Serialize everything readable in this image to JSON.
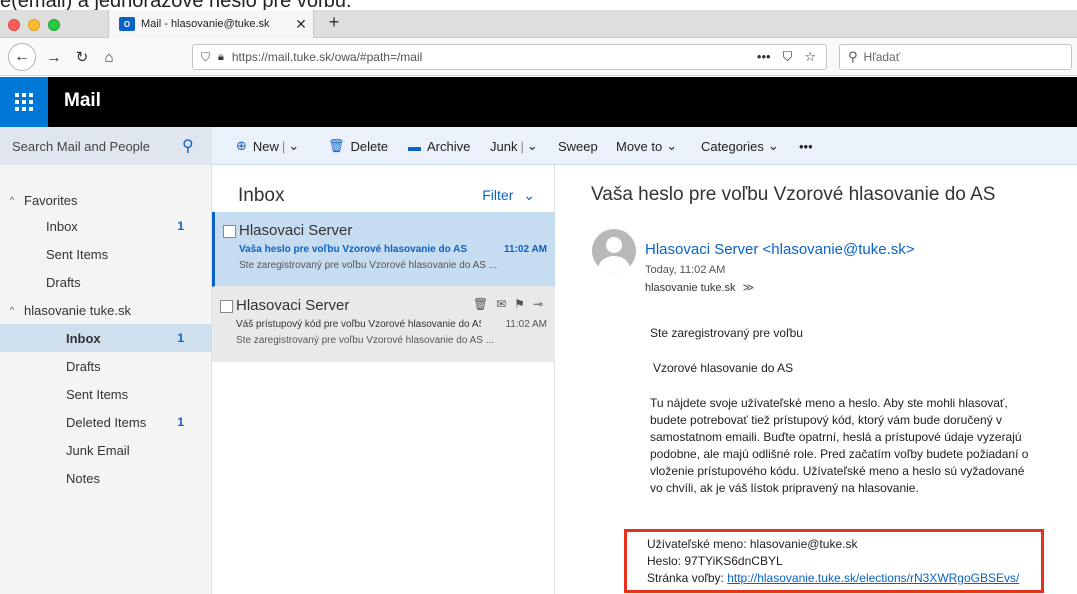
{
  "caption": "e(email) a jednorázové heslo pre voľbu.",
  "browser": {
    "tab_favicon": "O",
    "tab_title": "Mail - hlasovanie@tuke.sk",
    "url": "https://mail.tuke.sk/owa/#path=/mail",
    "search_placeholder": "Hľadať"
  },
  "app": {
    "title": "Mail"
  },
  "cmdbar": {
    "search_label": "Search Mail and People",
    "new": "New",
    "delete": "Delete",
    "archive": "Archive",
    "junk": "Junk",
    "sweep": "Sweep",
    "move_to": "Move to",
    "categories": "Categories",
    "more": "•••"
  },
  "leftnav": {
    "favorites": "Favorites",
    "fav_inbox": "Inbox",
    "fav_inbox_count": "1",
    "fav_sent": "Sent Items",
    "fav_drafts": "Drafts",
    "account": "hlasovanie tuke.sk",
    "inbox": "Inbox",
    "inbox_count": "1",
    "drafts": "Drafts",
    "sent": "Sent Items",
    "deleted": "Deleted Items",
    "deleted_count": "1",
    "junk": "Junk Email",
    "notes": "Notes"
  },
  "list": {
    "title": "Inbox",
    "filter": "Filter",
    "messages": [
      {
        "from": "Hlasovaci Server",
        "subject": "Vaša heslo pre voľbu Vzorové hlasovanie do AS",
        "time": "11:02 AM",
        "preview": "Ste zaregistrovaný pre voľbu Vzorové hlasovanie do AS ..."
      },
      {
        "from": "Hlasovaci Server",
        "subject": "Váš prístupový kód pre voľbu Vzorové hlasovanie do AS",
        "time": "11:02 AM",
        "preview": "Ste zaregistrovaný pre voľbu Vzorové hlasovanie do AS ..."
      }
    ]
  },
  "reading": {
    "subject": "Vaša heslo pre voľbu Vzorové hlasovanie do AS",
    "from": "Hlasovaci Server <hlasovanie@tuke.sk>",
    "date": "Today, 11:02 AM",
    "to": "hlasovanie tuke.sk",
    "body_intro": "Ste zaregistrovaný pre voľbu",
    "body_election": "Vzorové hlasovanie do AS",
    "body_text": "Tu nájdete svoje užívateľské meno a heslo. Aby ste mohli hlasovať, budete potrebovať tiež prístupový kód, ktorý vám bude doručený v samostatnom emaili. Buďte opatrní, heslá a prístupové údaje vyzerajú podobne, ale majú odlišné role. Pred začatím voľby budete požiadaní o vloženie prístupového kódu. Užívateľské meno a heslo sú vyžadované vo chvíli, ak je váš lístok pripravený na hlasovanie.",
    "username_line": "Užívateľské meno: hlasovanie@tuke.sk",
    "password_line": "Heslo: 97TYiKS6dnCBYL",
    "page_label": "Stránka voľby: ",
    "page_link": "http://hlasovanie.tuke.sk/elections/rN3XWRgoGBSEvs/"
  },
  "colors": {
    "accent": "#0a62c6",
    "highlight_box": "#e8311b",
    "appbar": "#000000",
    "waffle": "#0078d7"
  }
}
